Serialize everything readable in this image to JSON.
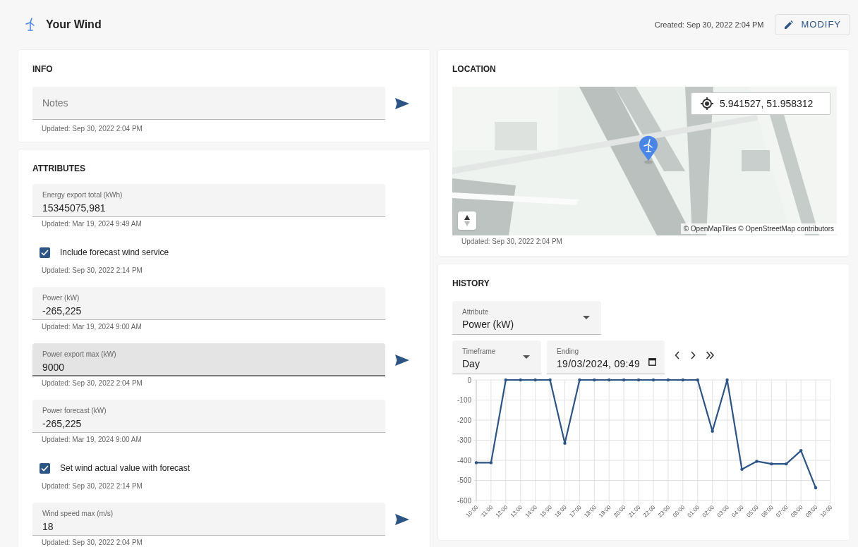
{
  "header": {
    "title": "Your Wind",
    "created": "Created: Sep 30, 2022 2:04 PM",
    "modify_button": "MODIFY"
  },
  "info": {
    "title": "INFO",
    "notes_field": {
      "placeholder": "Notes"
    },
    "updated": "Updated: Sep 30, 2022 2:04 PM"
  },
  "attributes": {
    "title": "ATTRIBUTES",
    "items": [
      {
        "kind": "field",
        "label": "Energy export total (kWh)",
        "value": "15345075,981",
        "updated": "Updated: Mar 19, 2024 9:49 AM",
        "send_button": false,
        "hovered": false
      },
      {
        "kind": "checkbox",
        "label": "Include forecast wind service",
        "checked": true,
        "updated": "Updated: Sep 30, 2022 2:14 PM"
      },
      {
        "kind": "field",
        "label": "Power (kW)",
        "value": "-265,225",
        "updated": "Updated: Mar 19, 2024 9:00 AM",
        "send_button": false,
        "hovered": false
      },
      {
        "kind": "field",
        "label": "Power export max (kW)",
        "value": "9000",
        "updated": "Updated: Sep 30, 2022 2:04 PM",
        "send_button": true,
        "hovered": true
      },
      {
        "kind": "field",
        "label": "Power forecast (kW)",
        "value": "-265,225",
        "updated": "Updated: Mar 19, 2024 9:00 AM",
        "send_button": false,
        "hovered": false
      },
      {
        "kind": "checkbox",
        "label": "Set wind actual value with forecast",
        "checked": true,
        "updated": "Updated: Sep 30, 2022 2:14 PM"
      },
      {
        "kind": "field",
        "label": "Wind speed max (m/s)",
        "value": "18",
        "updated": "Updated: Sep 30, 2022 2:04 PM",
        "send_button": true,
        "hovered": false
      }
    ]
  },
  "location": {
    "title": "LOCATION",
    "coordinates": "5.941527, 51.958312",
    "attribution": "© OpenMapTiles © OpenStreetMap contributors",
    "updated": "Updated: Sep 30, 2022 2:04 PM"
  },
  "history": {
    "title": "HISTORY",
    "attribute_select": {
      "label": "Attribute",
      "value": "Power (kW)"
    },
    "timeframe_select": {
      "label": "Timeframe",
      "value": "Day"
    },
    "ending_field": {
      "label": "Ending",
      "value": "19/03/2024, 09:49"
    },
    "chart_data": {
      "type": "line",
      "categories": [
        "10:00",
        "11:00",
        "12:00",
        "13:00",
        "14:00",
        "15:00",
        "16:00",
        "17:00",
        "18:00",
        "19:00",
        "20:00",
        "21:00",
        "22:00",
        "23:00",
        "00:00",
        "01:00",
        "02:00",
        "03:00",
        "04:00",
        "05:00",
        "06:00",
        "07:00",
        "08:00",
        "09:00",
        "10:00"
      ],
      "grid": true,
      "series": [
        {
          "color": "#2c5585",
          "values": [
            -412,
            -412,
            0,
            0,
            0,
            0,
            -315,
            0,
            0,
            0,
            0,
            0,
            0,
            0,
            0,
            0,
            -255,
            0,
            -445,
            -405,
            -418,
            -418,
            -352,
            -537,
            null
          ]
        }
      ],
      "ylim": [
        -600,
        0
      ],
      "yticks": [
        0,
        -100,
        -200,
        -300,
        -400,
        -500,
        -600
      ]
    }
  }
}
